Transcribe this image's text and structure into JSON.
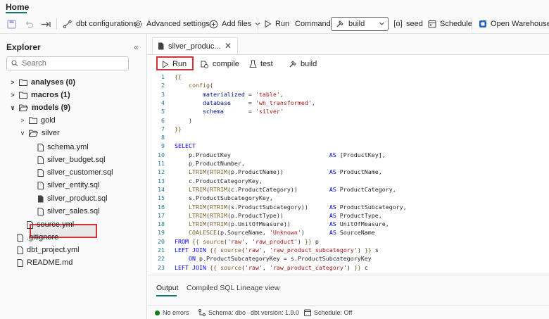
{
  "header": {
    "home_tab": "Home"
  },
  "toolbar": {
    "dbt_configurations": "dbt configurations",
    "advanced_settings": "Advanced settings",
    "add_files": "Add files",
    "run": "Run",
    "command": "Command",
    "build_value": "build",
    "seed": "seed",
    "schedule": "Schedule",
    "open_warehouse": "Open Warehouse"
  },
  "explorer": {
    "title": "Explorer",
    "search_placeholder": "Search",
    "items": [
      {
        "label": "analyses (0)",
        "type": "folder",
        "expanded": false
      },
      {
        "label": "macros (1)",
        "type": "folder",
        "expanded": false
      },
      {
        "label": "models (9)",
        "type": "folder",
        "expanded": true
      },
      {
        "label": "gold",
        "type": "folder",
        "expanded": false
      },
      {
        "label": "silver",
        "type": "folder",
        "expanded": true
      },
      {
        "label": "schema.yml",
        "type": "file"
      },
      {
        "label": "silver_budget.sql",
        "type": "file"
      },
      {
        "label": "silver_customer.sql",
        "type": "file"
      },
      {
        "label": "silver_entity.sql",
        "type": "file"
      },
      {
        "label": "silver_product.sql",
        "type": "file",
        "selected": true
      },
      {
        "label": "silver_sales.sql",
        "type": "file"
      },
      {
        "label": "source.yml",
        "type": "file"
      },
      {
        "label": ".gitignore",
        "type": "file"
      },
      {
        "label": "dbt_project.yml",
        "type": "file"
      },
      {
        "label": "README.md",
        "type": "file"
      }
    ]
  },
  "editor": {
    "file_tab": "silver_produc...",
    "actions": {
      "run": "Run",
      "compile": "compile",
      "test": "test",
      "build": "build"
    },
    "lines": [
      "{{",
      "    config(",
      "        materialized = 'table',",
      "        database     = 'wh_transformed',",
      "        schema       = 'silver'",
      "    )",
      "}}",
      "",
      "SELECT",
      "    p.ProductKey                            AS [ProductKey],",
      "    p.ProductNumber,",
      "    LTRIM(RTRIM(p.ProductName))             AS ProductName,",
      "    c.ProductCategoryKey,",
      "    LTRIM(RTRIM(c.ProductCategory))         AS ProductCategory,",
      "    s.ProductSubcategoryKey,",
      "    LTRIM(RTRIM(s.ProductSubcategory))      AS ProductSubcategory,",
      "    LTRIM(RTRIM(p.ProductType))             AS ProductType,",
      "    LTRIM(RTRIM(p.UnitOfMeasure))           AS UnitOfMeasure,",
      "    COALESCE(p.SourceName, 'Unknown')       AS SourceName",
      "FROM {{ source('raw', 'raw_product') }} p",
      "LEFT JOIN {{ source('raw', 'raw_product_subcategory') }} s",
      "    ON p.ProductSubcategoryKey = s.ProductSubcategoryKey",
      "LEFT JOIN {{ source('raw', 'raw_product_category') }} c"
    ]
  },
  "output": {
    "tabs": [
      "Output",
      "Compiled SQL",
      "Lineage view"
    ]
  },
  "status": {
    "errors": "No errors",
    "schema": "Schema: dbo",
    "dbt_version": "dbt version: 1.9.0",
    "schedule": "Schedule: Off"
  },
  "colors": {
    "accent": "#117865",
    "highlight": "#d13438",
    "ok": "#107c10"
  }
}
